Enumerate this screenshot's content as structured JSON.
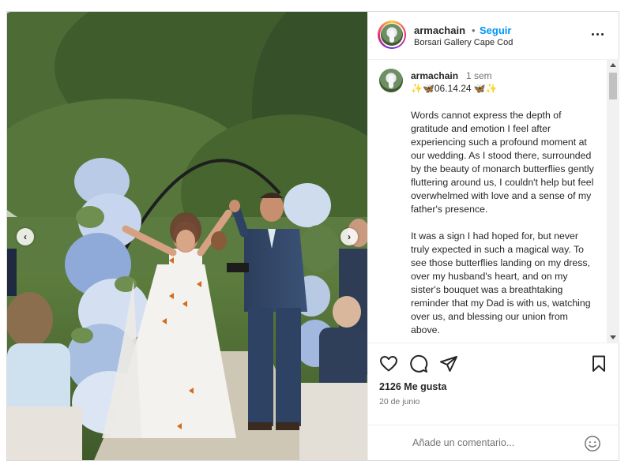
{
  "header": {
    "username": "armachain",
    "separator": "•",
    "follow_label": "Seguir",
    "location": "Borsari Gallery Cape Cod"
  },
  "post": {
    "username": "armachain",
    "time_ago": "1 sem",
    "emoji_line": "✨🦋06.14.24 🦋✨",
    "caption": [
      "Words cannot express the depth of gratitude and emotion I feel after experiencing such a profound moment at our wedding. As I stood there, surrounded by the beauty of monarch butterflies gently fluttering around us, I couldn't help but feel overwhelmed with love and a sense of my father's presence.",
      "It was a sign I had hoped for, but never truly expected in such a magical way. To see those butterflies landing on my dress, over my husband's heart, and on my sister's bouquet was a breathtaking reminder that my Dad is with us, watching over us, and blessing our union from above."
    ]
  },
  "actions": {
    "likes": "2126 Me gusta",
    "date": "20 de junio",
    "comment_placeholder": "Añade un comentario..."
  },
  "icons": {
    "like": "heart-icon",
    "comment": "comment-icon",
    "share": "send-icon",
    "save": "bookmark-icon",
    "emoji": "smile-icon",
    "more": "more-icon",
    "prev": "chevron-left-icon",
    "next": "chevron-right-icon"
  },
  "colors": {
    "follow": "#0095f6",
    "text": "#262626",
    "muted": "#737373"
  }
}
